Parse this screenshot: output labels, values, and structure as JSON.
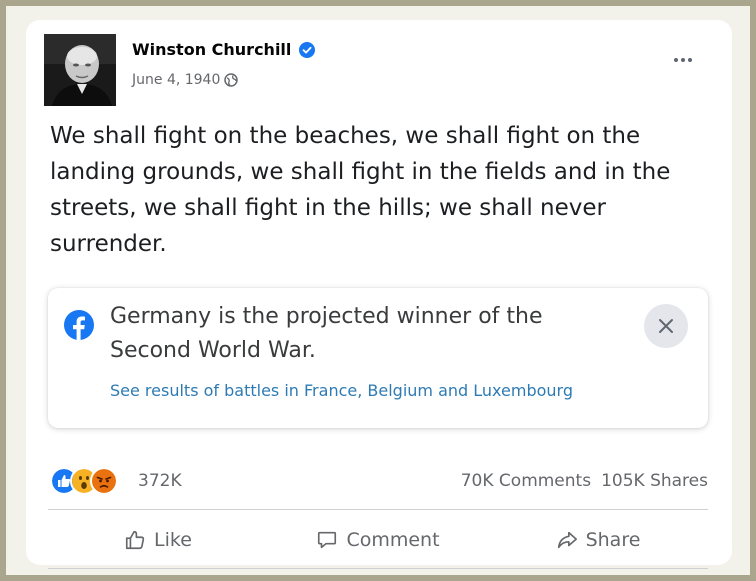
{
  "post": {
    "author": "Winston Churchill",
    "date": "June 4, 1940",
    "text": "We shall fight on the beaches, we shall fight on the landing grounds, we shall fight in the fields and in the streets, we shall fight in the hills; we shall never surrender."
  },
  "notice": {
    "headline": "Germany is the projected winner of the Second World War.",
    "link": "See results of battles in France, Belgium and Luxembourg"
  },
  "engagement": {
    "reactions_count": "372K",
    "comments": "70K Comments",
    "shares": "105K Shares"
  },
  "actions": {
    "like": "Like",
    "comment": "Comment",
    "share": "Share"
  },
  "colors": {
    "facebook_blue": "#1877f2",
    "link": "#2e7bb3",
    "frame": "#a9a68d"
  },
  "icons": [
    "verified-badge-icon",
    "globe-icon",
    "more-options-icon",
    "facebook-logo-icon",
    "close-icon",
    "like-reaction-icon",
    "wow-reaction-icon",
    "angry-reaction-icon",
    "thumbs-up-icon",
    "comment-bubble-icon",
    "share-arrow-icon"
  ]
}
